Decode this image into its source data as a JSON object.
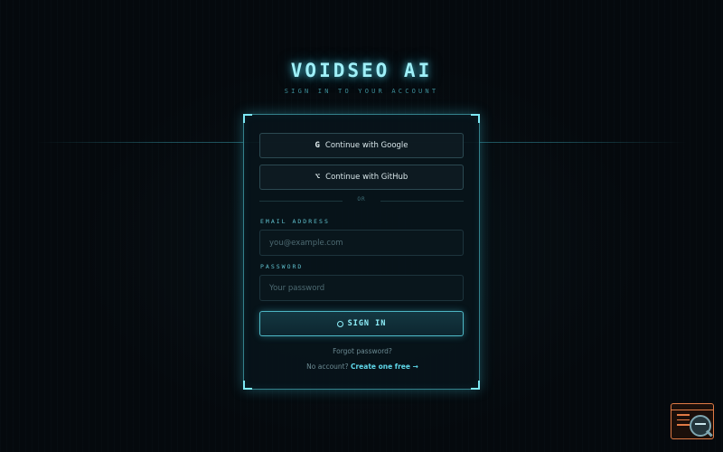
{
  "brand": {
    "title": "VOIDSEO AI",
    "subtitle": "SIGN IN TO YOUR ACCOUNT"
  },
  "oauth": {
    "google": {
      "icon": "G",
      "label": "Continue with Google"
    },
    "github": {
      "icon": "⌥",
      "label": "Continue with GitHub"
    }
  },
  "divider": {
    "text": "OR"
  },
  "form": {
    "email": {
      "label": "EMAIL ADDRESS",
      "placeholder": "you@example.com",
      "value": ""
    },
    "password": {
      "label": "PASSWORD",
      "placeholder": "Your password",
      "value": ""
    },
    "submit_label": "SIGN IN"
  },
  "links": {
    "forgot": "Forgot password?",
    "no_account": "No account?",
    "create": "Create one free →"
  },
  "colors": {
    "accent": "#5fd8ea",
    "background": "#05090d",
    "card_border": "#7de8f5",
    "widget": "#e07a45"
  },
  "icons": {
    "submit": "ring-icon",
    "google": "google-icon",
    "github": "github-icon",
    "corner_widget": "browser-inspect-icon"
  }
}
